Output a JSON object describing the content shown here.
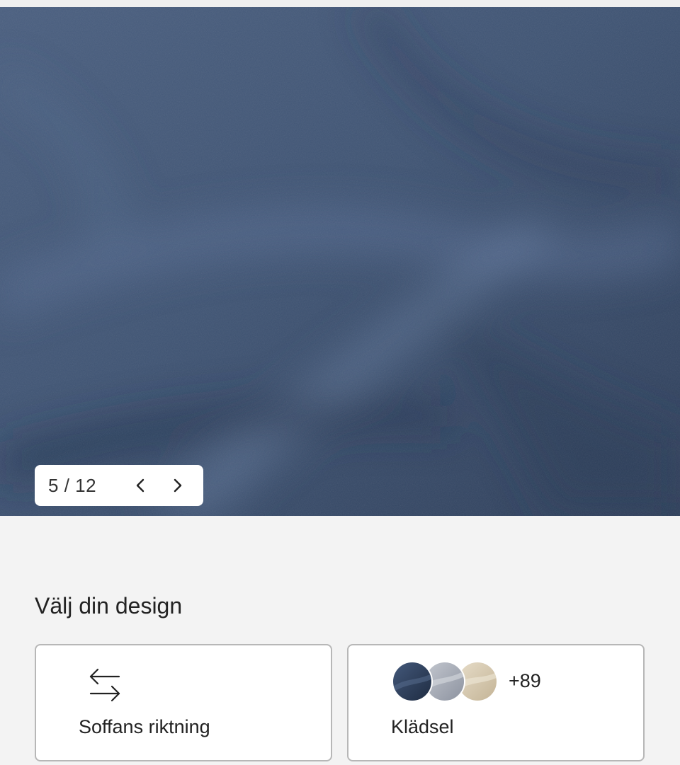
{
  "gallery": {
    "image_description_icon": "blue-velvet-fabric-image",
    "fabric_color": "#3f5474",
    "pager": {
      "current": "5",
      "separator": "/",
      "total": "12",
      "prev_icon": "chevron-left-icon",
      "next_icon": "chevron-right-icon"
    }
  },
  "design": {
    "title": "Välj din design",
    "direction_card": {
      "icon": "swap-arrows-icon",
      "label": "Soffans riktning"
    },
    "upholstery_card": {
      "swatch_colors": [
        "#2f3f5a",
        "#a6abb5",
        "#d8cbb3"
      ],
      "more_count": "+89",
      "label": "Klädsel"
    }
  }
}
